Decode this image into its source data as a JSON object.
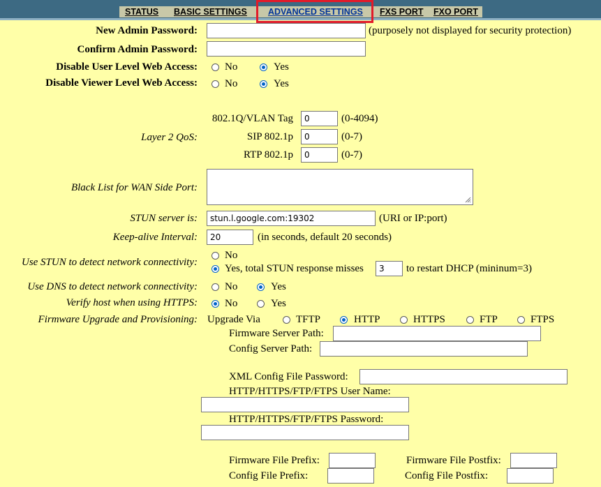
{
  "nav": {
    "tabs": [
      {
        "label": "STATUS"
      },
      {
        "label": "BASIC SETTINGS"
      },
      {
        "label": "ADVANCED SETTINGS"
      },
      {
        "label": "FXS PORT"
      },
      {
        "label": "FXO PORT"
      }
    ],
    "active_tab": "ADVANCED SETTINGS"
  },
  "form": {
    "new_admin_password": {
      "label": "New Admin Password:",
      "value": "",
      "note": "(purposely not displayed for security protection)"
    },
    "confirm_admin_password": {
      "label": "Confirm Admin Password:",
      "value": ""
    },
    "disable_user_web": {
      "label": "Disable User Level Web Access:",
      "options": [
        "No",
        "Yes"
      ],
      "selected": "Yes"
    },
    "disable_viewer_web": {
      "label": "Disable Viewer Level Web Access:",
      "options": [
        "No",
        "Yes"
      ],
      "selected": "Yes"
    },
    "layer2_qos": {
      "label": "Layer 2 QoS:",
      "vlan": {
        "label": "802.1Q/VLAN Tag",
        "value": "0",
        "range": "(0-4094)"
      },
      "sip": {
        "label": "SIP 802.1p",
        "value": "0",
        "range": "(0-7)"
      },
      "rtp": {
        "label": "RTP 802.1p",
        "value": "0",
        "range": "(0-7)"
      }
    },
    "black_list": {
      "label": "Black List for WAN Side Port:",
      "value": ""
    },
    "stun_server": {
      "label": "STUN server is:",
      "value": "stun.l.google.com:19302",
      "note": "(URI or IP:port)"
    },
    "keep_alive": {
      "label": "Keep-alive Interval:",
      "value": "20",
      "note": "(in seconds, default 20 seconds)"
    },
    "use_stun": {
      "label": "Use STUN to detect network connectivity:",
      "no_label": "No",
      "yes_label": "Yes, total STUN response misses",
      "misses_value": "3",
      "suffix": "to restart DHCP (mininum=3)",
      "selected": "Yes"
    },
    "use_dns": {
      "label": "Use DNS to detect network connectivity:",
      "options": [
        "No",
        "Yes"
      ],
      "selected": "Yes"
    },
    "verify_host": {
      "label": "Verify host when using HTTPS:",
      "options": [
        "No",
        "Yes"
      ],
      "selected": "No"
    },
    "firmware": {
      "label": "Firmware Upgrade and Provisioning:",
      "upgrade_via_label": "Upgrade Via",
      "options": [
        "TFTP",
        "HTTP",
        "HTTPS",
        "FTP",
        "FTPS"
      ],
      "selected": "HTTP",
      "firmware_server_path": {
        "label": "Firmware Server Path:",
        "value": ""
      },
      "config_server_path": {
        "label": "Config Server Path:",
        "value": ""
      },
      "xml_password": {
        "label": "XML Config File Password:",
        "value": ""
      },
      "user_name": {
        "label": "HTTP/HTTPS/FTP/FTPS User Name:",
        "value": ""
      },
      "password": {
        "label": "HTTP/HTTPS/FTP/FTPS Password:",
        "value": ""
      },
      "firmware_prefix": {
        "label": "Firmware File Prefix:",
        "value": ""
      },
      "firmware_postfix": {
        "label": "Firmware File Postfix:",
        "value": ""
      },
      "config_prefix": {
        "label": "Config File Prefix:",
        "value": ""
      },
      "config_postfix": {
        "label": "Config File Postfix:",
        "value": ""
      }
    }
  },
  "colors": {
    "background": "#ffffa8",
    "header": "#3d6a83",
    "tab_strip": "#c8c8a8",
    "highlight": "#e21b2a",
    "radio_selected": "#0061c7"
  }
}
